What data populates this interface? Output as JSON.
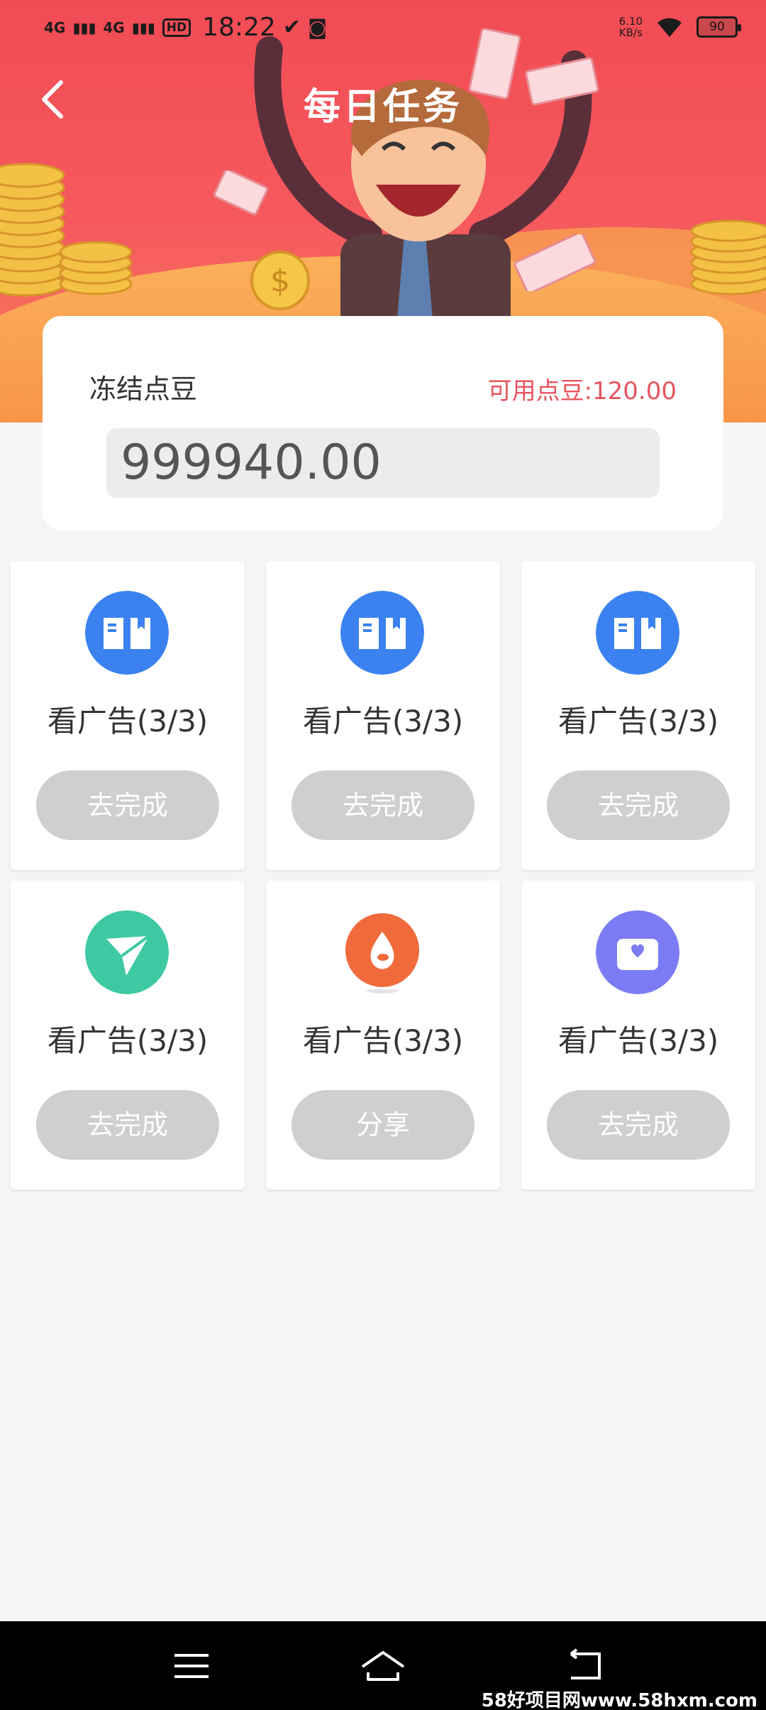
{
  "status_bar": {
    "signal1": "4G",
    "signal2": "4G",
    "hd_badge": "HD",
    "time": "18:22",
    "net_speed_value": "6.10",
    "net_speed_unit": "KB/s",
    "battery": "90"
  },
  "header": {
    "title": "每日任务",
    "back_icon": "chevron-left-icon"
  },
  "balance_card": {
    "frozen_label": "冻结点豆",
    "available_text": "可用点豆:120.00",
    "frozen_value": "999940.00"
  },
  "tasks": [
    {
      "icon": "book-icon",
      "label": "看广告(3/3)",
      "button": "去完成",
      "color": "#3b82f0"
    },
    {
      "icon": "book-icon",
      "label": "看广告(3/3)",
      "button": "去完成",
      "color": "#3b82f0"
    },
    {
      "icon": "book-icon",
      "label": "看广告(3/3)",
      "button": "去完成",
      "color": "#3b82f0"
    },
    {
      "icon": "paper-plane-icon",
      "label": "看广告(3/3)",
      "button": "去完成",
      "color": "#3ec9a3"
    },
    {
      "icon": "flame-drop-icon",
      "label": "看广告(3/3)",
      "button": "分享",
      "color": "#f06a3c"
    },
    {
      "icon": "envelope-heart-icon",
      "label": "看广告(3/3)",
      "button": "去完成",
      "color": "#7b7bf5"
    }
  ],
  "nav_bar": {
    "menu_icon": "menu-icon",
    "home_icon": "home-icon",
    "back_icon": "back-icon"
  },
  "watermark": "58好项目网www.58hxm.com"
}
